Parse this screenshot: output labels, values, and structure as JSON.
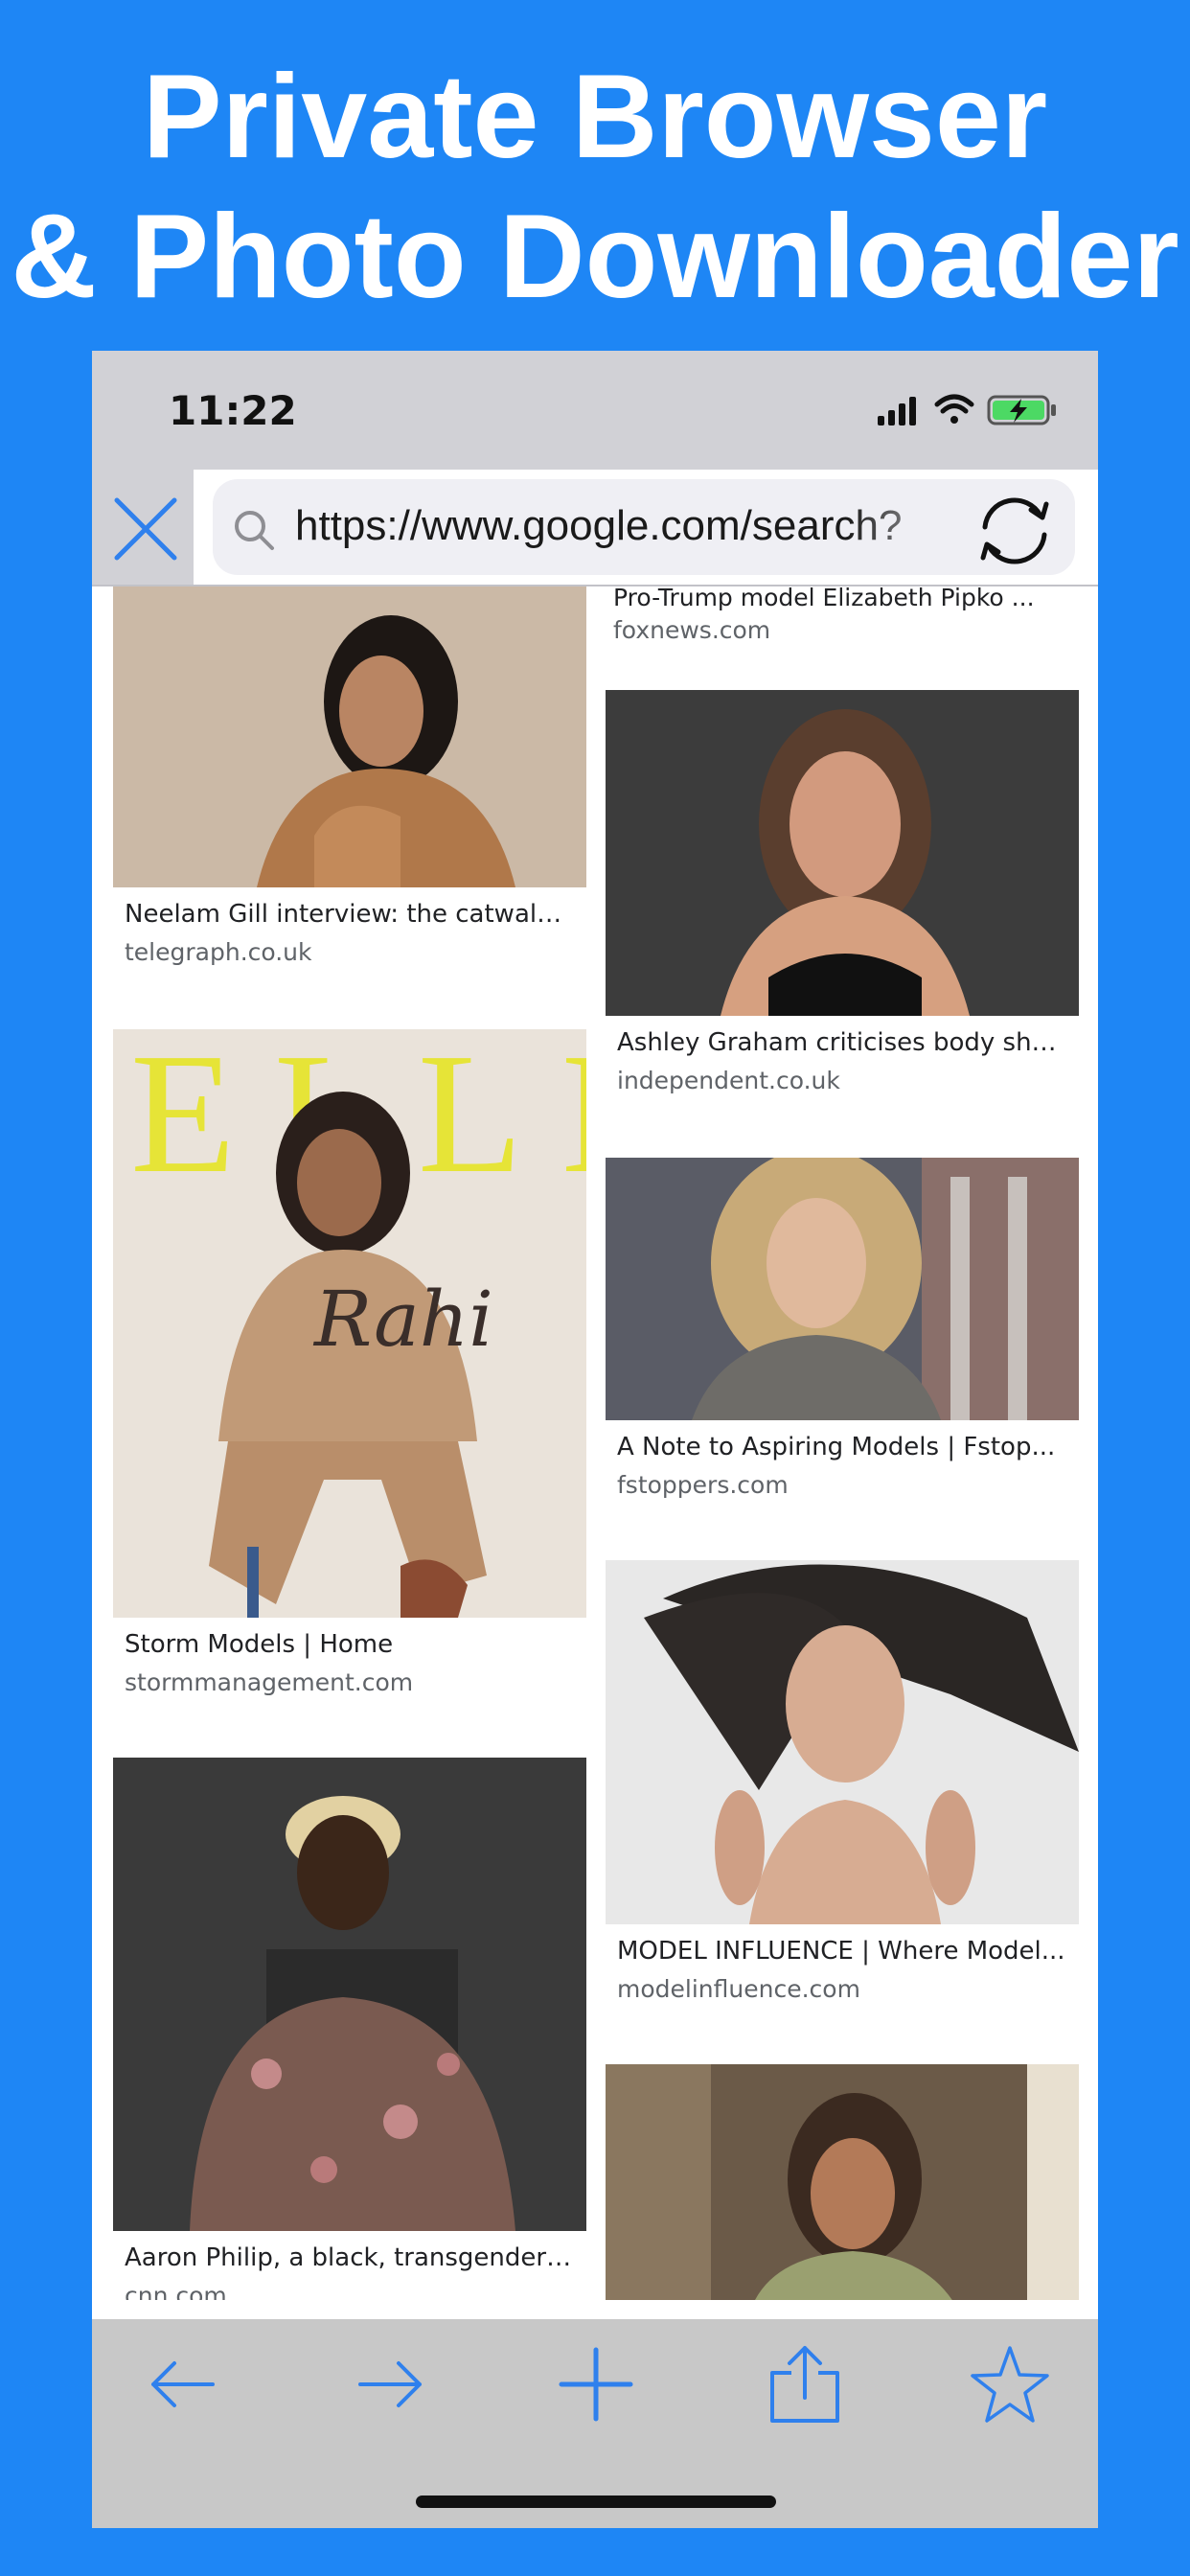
{
  "headline": {
    "line1": "Private Browser",
    "line2": "& Photo Downloader"
  },
  "status_bar": {
    "time": "11:22",
    "icons": [
      "cellular-signal-icon",
      "wifi-icon",
      "battery-charging-icon"
    ]
  },
  "url_bar": {
    "url": "https://www.google.com/search?",
    "close_icon": "close-icon",
    "search_icon": "search-icon",
    "reload_icon": "reload-icon"
  },
  "results": {
    "top_partial": {
      "title": "Pro-Trump model Elizabeth Pipko ...",
      "source": "foxnews.com"
    },
    "left_column": [
      {
        "title": "Neelam Gill interview: the catwalk ...",
        "source": "telegraph.co.uk"
      },
      {
        "title": "Storm Models | Home",
        "source": "stormmanagement.com",
        "cover_text": "ELLE",
        "cover_name": "Rahi"
      },
      {
        "title": "Aaron Philip, a black, transgender ...",
        "source": "cnn.com"
      }
    ],
    "right_column": [
      {
        "title": "Ashley Graham criticises body sha...",
        "source": "independent.co.uk"
      },
      {
        "title": "A Note to Aspiring Models | Fstop...",
        "source": "fstoppers.com"
      },
      {
        "title": "MODEL INFLUENCE | Where Model...",
        "source": "modelinfluence.com"
      },
      {
        "title": "",
        "source": ""
      }
    ]
  },
  "toolbar": {
    "buttons": [
      "back-arrow-icon",
      "forward-arrow-icon",
      "plus-icon",
      "share-icon",
      "star-icon"
    ]
  },
  "colors": {
    "background": "#1E86F5",
    "accent": "#2F80ED",
    "bar_gray": "#D1D1D6",
    "toolbar_gray": "#C8C8C8"
  }
}
